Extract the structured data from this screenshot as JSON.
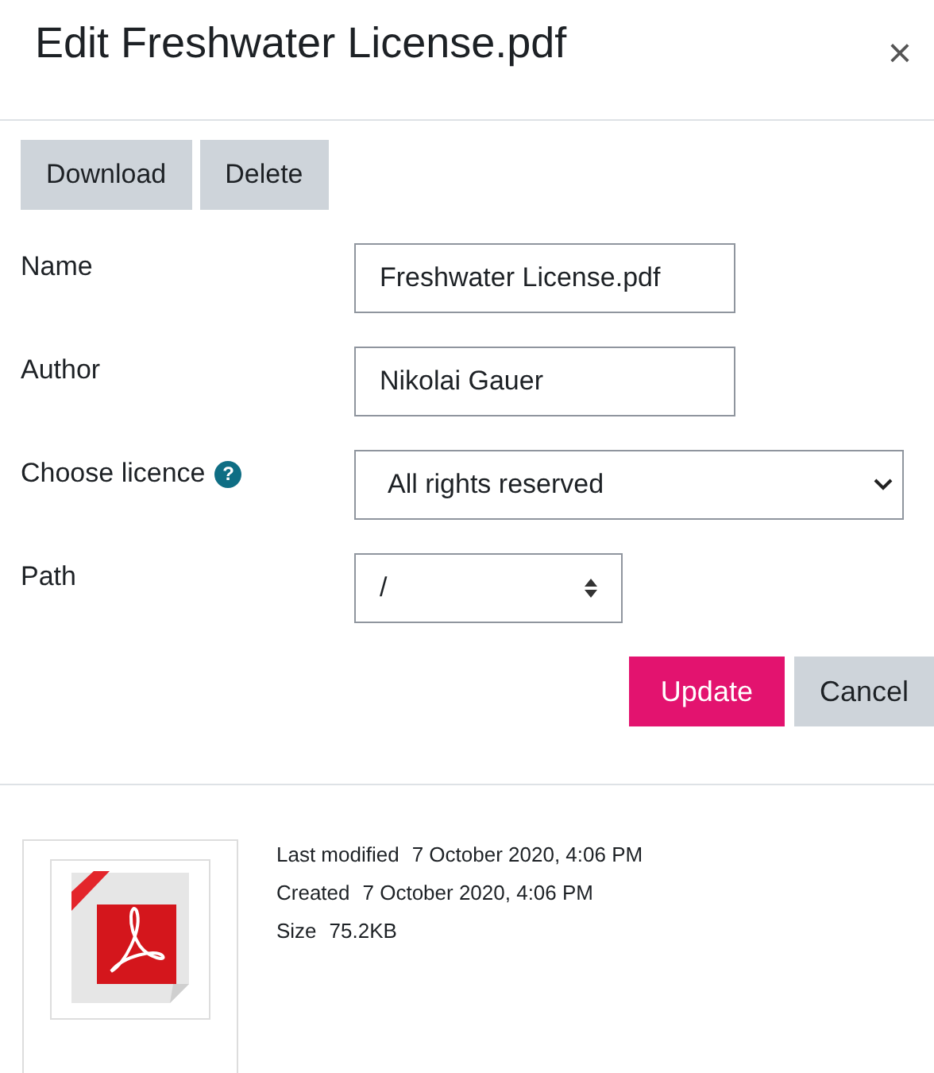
{
  "dialog": {
    "title": "Edit Freshwater License.pdf",
    "close": "×"
  },
  "actions": [
    "Download",
    "Delete"
  ],
  "fields": [
    {
      "kind": "text",
      "label": "Name",
      "value": "Freshwater License.pdf"
    },
    {
      "kind": "text",
      "label": "Author",
      "value": "Nikolai Gauer"
    },
    {
      "kind": "select",
      "label": "Choose licence",
      "help": "?",
      "value": "All rights reserved"
    },
    {
      "kind": "spinner",
      "label": "Path",
      "value": "/"
    }
  ],
  "buttons": [
    {
      "label": "Update",
      "primary": true
    },
    {
      "label": "Cancel",
      "primary": false
    }
  ],
  "file_info": [
    {
      "label": "Last modified",
      "value": "7 October 2020, 4:06 PM"
    },
    {
      "label": "Created",
      "value": "7 October 2020, 4:06 PM"
    },
    {
      "label": "Size",
      "value": "75.2KB"
    }
  ]
}
